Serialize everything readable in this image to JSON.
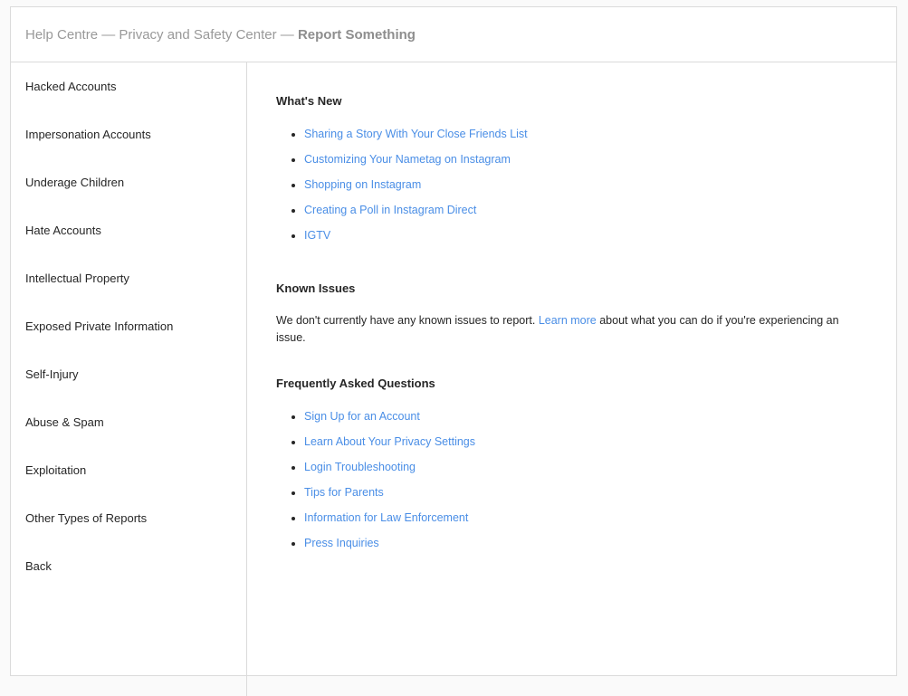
{
  "header": {
    "breadcrumb_prefix": "Help Centre — Privacy and Safety Center — ",
    "current": "Report Something"
  },
  "sidebar": {
    "items": [
      {
        "label": "Hacked Accounts"
      },
      {
        "label": "Impersonation Accounts"
      },
      {
        "label": "Underage Children"
      },
      {
        "label": "Hate Accounts"
      },
      {
        "label": "Intellectual Property"
      },
      {
        "label": "Exposed Private Information"
      },
      {
        "label": "Self-Injury"
      },
      {
        "label": "Abuse & Spam"
      },
      {
        "label": "Exploitation"
      },
      {
        "label": "Other Types of Reports"
      },
      {
        "label": "Back"
      }
    ]
  },
  "main": {
    "whats_new": {
      "title": "What's New",
      "links": [
        "Sharing a Story With Your Close Friends List",
        "Customizing Your Nametag on Instagram",
        "Shopping on Instagram",
        "Creating a Poll in Instagram Direct",
        "IGTV"
      ]
    },
    "known_issues": {
      "title": "Known Issues",
      "text_before": "We don't currently have any known issues to report. ",
      "link": "Learn more",
      "text_after": " about what you can do if you're experiencing an issue."
    },
    "faq": {
      "title": "Frequently Asked Questions",
      "links": [
        "Sign Up for an Account",
        "Learn About Your Privacy Settings",
        "Login Troubleshooting",
        "Tips for Parents",
        "Information for Law Enforcement",
        "Press Inquiries"
      ]
    }
  },
  "colors": {
    "link": "#4a8ee6",
    "text": "#262626",
    "muted": "#999999",
    "border": "#dbdbdb"
  }
}
